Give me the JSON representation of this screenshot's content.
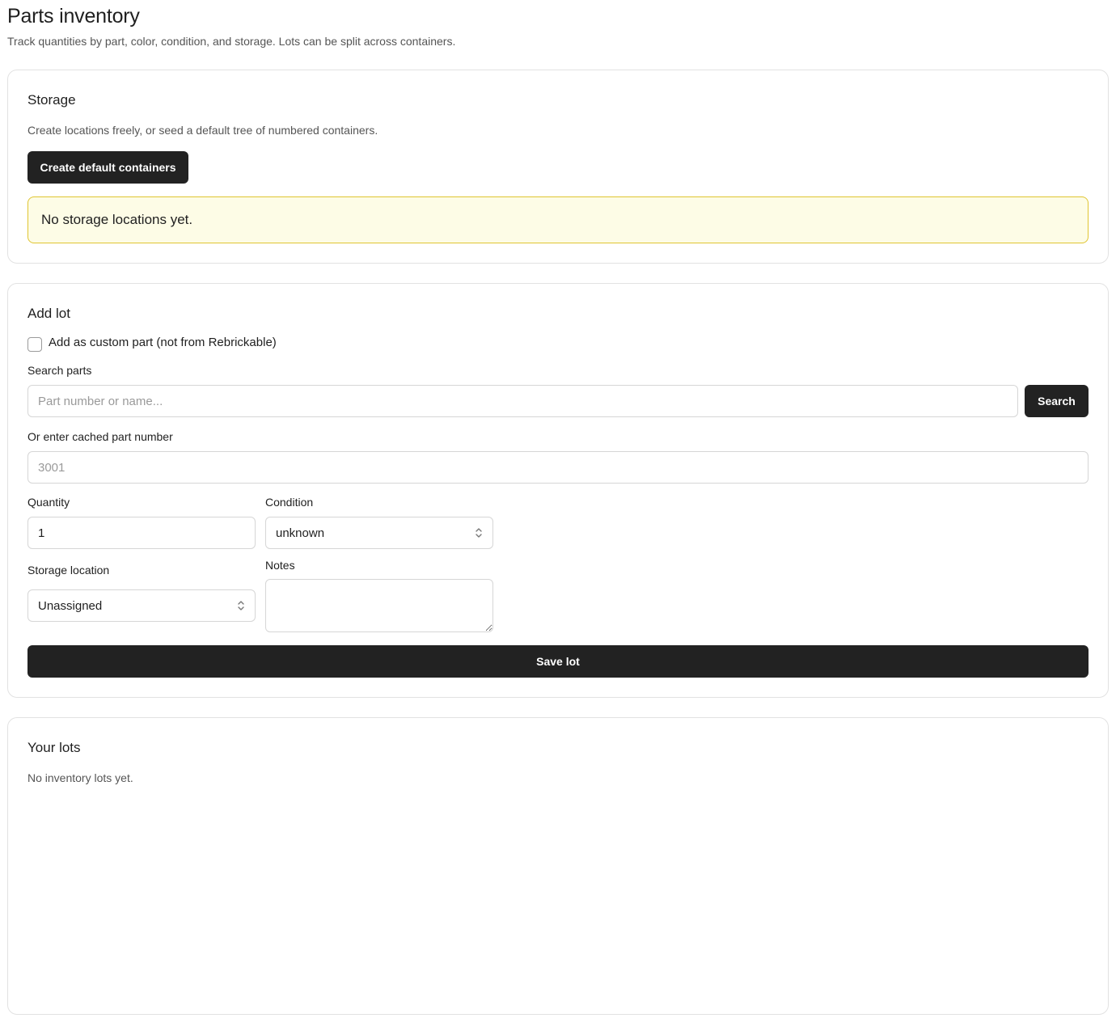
{
  "header": {
    "title": "Parts inventory",
    "subtitle": "Track quantities by part, color, condition, and storage. Lots can be split across containers."
  },
  "storage": {
    "title": "Storage",
    "description": "Create locations freely, or seed a default tree of numbered containers.",
    "create_button": "Create default containers",
    "empty_notice": "No storage locations yet."
  },
  "add_lot": {
    "title": "Add lot",
    "custom_part_label": "Add as custom part (not from Rebrickable)",
    "custom_part_checked": false,
    "search_label": "Search parts",
    "search_placeholder": "Part number or name...",
    "search_value": "",
    "search_button": "Search",
    "cached_label": "Or enter cached part number",
    "cached_placeholder": "3001",
    "cached_value": "",
    "quantity_label": "Quantity",
    "quantity_value": "1",
    "condition_label": "Condition",
    "condition_value": "unknown",
    "storage_label": "Storage location",
    "storage_value": "Unassigned",
    "notes_label": "Notes",
    "notes_value": "",
    "save_button": "Save lot"
  },
  "lots": {
    "title": "Your lots",
    "empty_text": "No inventory lots yet."
  },
  "colors": {
    "button_bg": "#222222",
    "notice_bg": "#fdfce6",
    "notice_border": "#e0c531",
    "card_border": "#e2e2e2"
  }
}
